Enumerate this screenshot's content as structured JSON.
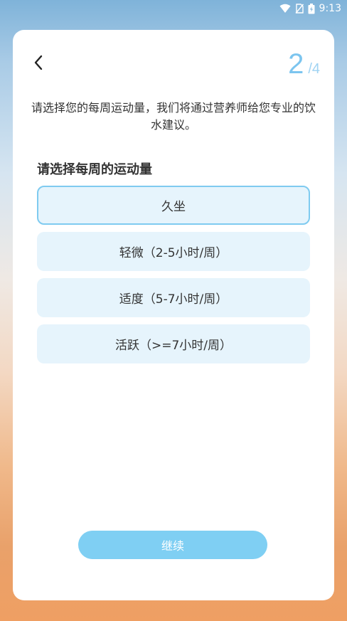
{
  "status_bar": {
    "time": "9:13",
    "icons": [
      "wifi-icon",
      "no-sim-icon",
      "battery-charging-icon"
    ]
  },
  "header": {
    "back_icon": "chevron-left-icon",
    "step_current": "2",
    "step_total": "/4"
  },
  "intro_text": "请选择您的每周运动量，我们将通过营养师给您专业的饮水建议。",
  "section_title": "请选择每周的运动量",
  "options": [
    {
      "label": "久坐",
      "selected": true
    },
    {
      "label": "轻微（2-5小时/周）",
      "selected": false
    },
    {
      "label": "适度（5-7小时/周）",
      "selected": false
    },
    {
      "label": "活跃（>=7小时/周）",
      "selected": false
    }
  ],
  "continue_label": "继续",
  "colors": {
    "accent": "#7fcff3",
    "option_bg": "#e6f4fc",
    "selected_border": "#7fcbf0",
    "text": "#333333"
  }
}
